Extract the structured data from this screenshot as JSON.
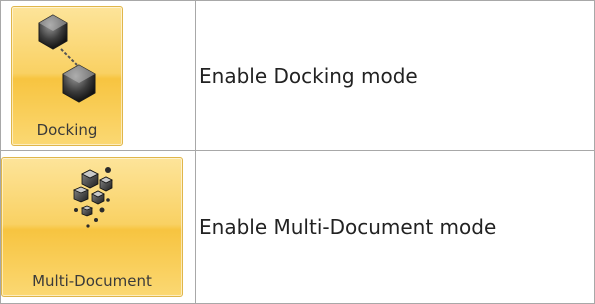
{
  "rows": [
    {
      "button_label": "Docking",
      "button_icon": "linked-hexagons-icon",
      "description": "Enable Docking mode"
    },
    {
      "button_label": "Multi-Document",
      "button_icon": "scattered-cubes-icon",
      "description": "Enable Multi-Document mode"
    }
  ],
  "colors": {
    "button_fill": "#f9d163",
    "button_border": "#e0b64a",
    "grid_border": "#a8a8a8",
    "text": "#222222"
  }
}
